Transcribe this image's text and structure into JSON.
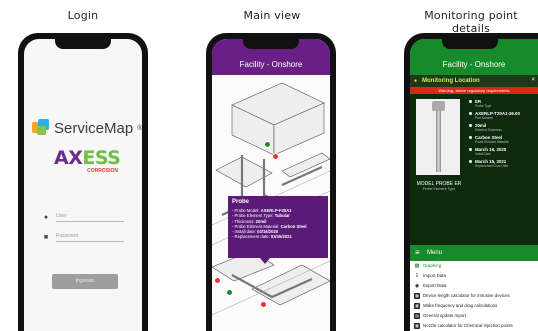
{
  "titles": {
    "login": "Login",
    "main": "Main view",
    "details": "Monitoring point details"
  },
  "login": {
    "brand": "ServiceMap",
    "brand_mark": "®",
    "partner_logo_a": "AX",
    "partner_logo_b": "ESS",
    "partner_sub": "CORROSION",
    "user_placeholder": "User",
    "password_placeholder": "Password",
    "submit_label": "Ingresar"
  },
  "main": {
    "header": "Facility - Onshore",
    "popup": {
      "title": "Probe",
      "lines": [
        {
          "label": "- Probe Model: ",
          "value": "AXERLP-F20A1"
        },
        {
          "label": "- Probe Element Type: ",
          "value": "Tubular"
        },
        {
          "label": "- Thickness: ",
          "value": "20mil"
        },
        {
          "label": "- Probe Element Material: ",
          "value": "Carbon Steel"
        },
        {
          "label": "- Install date: ",
          "value": "03/16/2020"
        },
        {
          "label": "- Replacement date: ",
          "value": "03/15/2021"
        }
      ]
    }
  },
  "details": {
    "header": "Facility - Onshore",
    "section_title": "Monitoring Location",
    "warning": "Warning: above regulatory requirements",
    "probe_caption": "MODEL PROBE ER",
    "probe_caption_sub": "Probe Element Type",
    "props": [
      {
        "value": "ER",
        "key": "Probe Type"
      },
      {
        "value": "AXERLP-T20A1-36.00",
        "key": "Part Number"
      },
      {
        "value": "20mil",
        "key": "Element Thickness"
      },
      {
        "value": "Carbon Steel",
        "key": "Probe Element Material"
      },
      {
        "value": "March 16, 2020",
        "key": "Install Date"
      },
      {
        "value": "March 15, 2021",
        "key": "Replacement Due Date"
      }
    ],
    "menu_title": "Menu",
    "menu_items": [
      {
        "label": "Graphing",
        "icon": "bar-chart-icon"
      },
      {
        "label": "Import Data",
        "icon": "import-icon"
      },
      {
        "label": "Export Data",
        "icon": "eye-icon"
      },
      {
        "label": "Device length calculator for intrusive devices",
        "icon": "calculator-icon"
      },
      {
        "label": "Wake frequency and drag calculations",
        "icon": "calculator-icon"
      },
      {
        "label": "General update report",
        "icon": "report-icon"
      },
      {
        "label": "Nozzle calculator for Chemical Injection points",
        "icon": "calculator-icon"
      }
    ]
  }
}
